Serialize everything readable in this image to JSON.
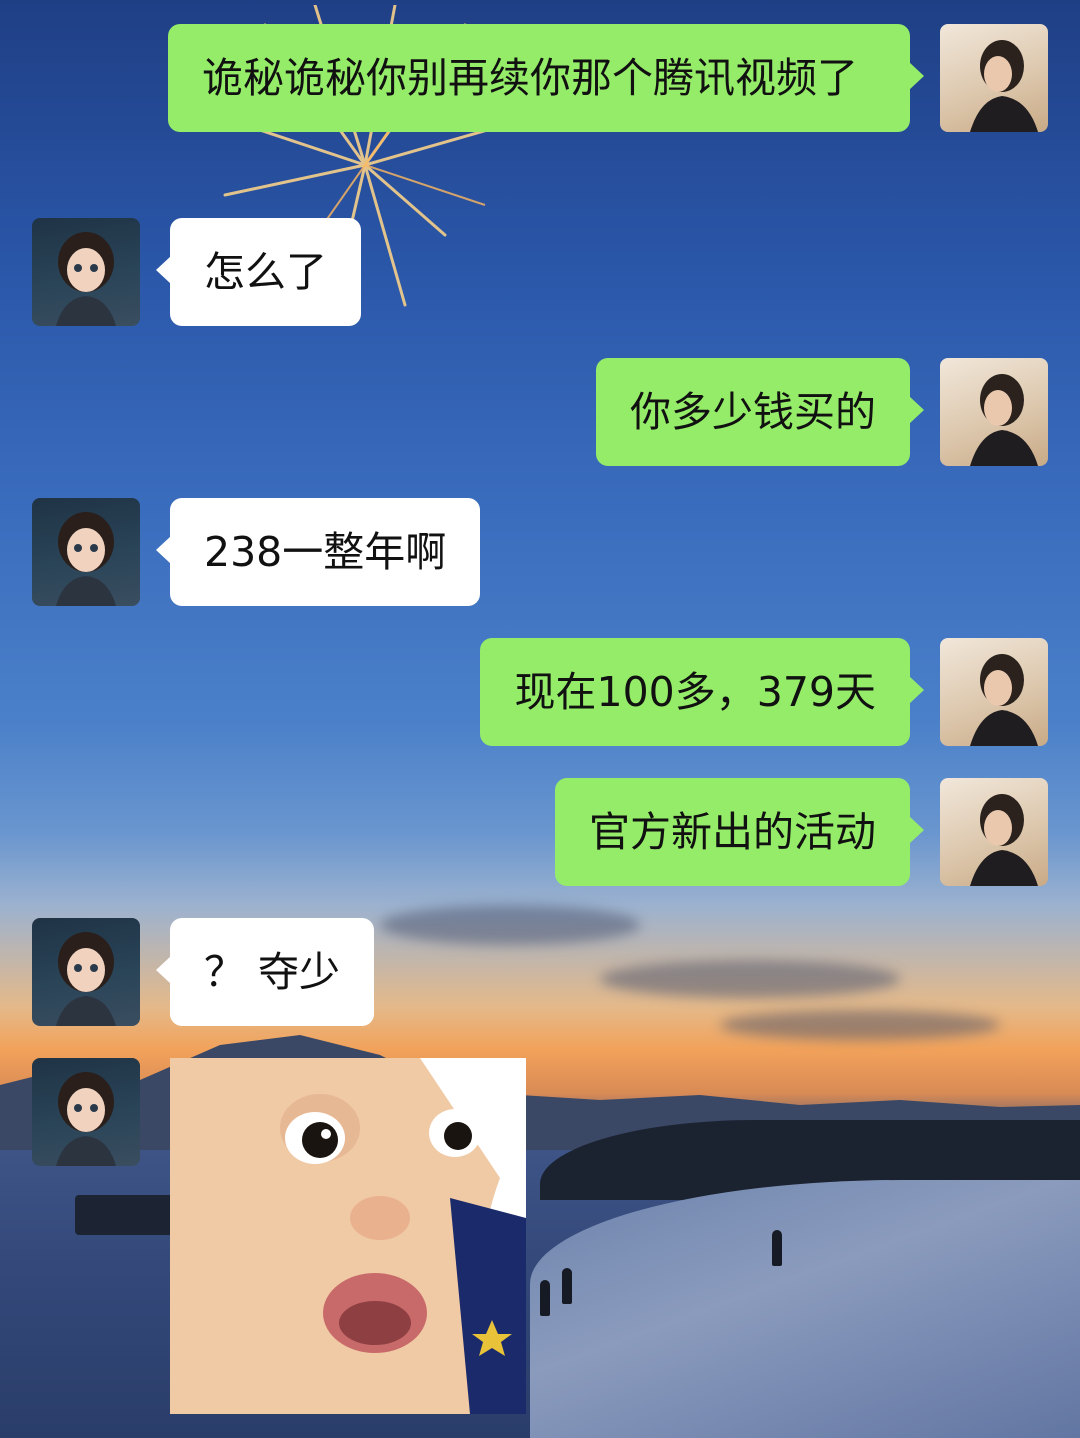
{
  "messages": [
    {
      "sender": "self",
      "text": "诡秘诡秘你别再续你那个腾讯视频了"
    },
    {
      "sender": "other",
      "text": "怎么了"
    },
    {
      "sender": "self",
      "text": "你多少钱买的"
    },
    {
      "sender": "other",
      "text": "238一整年啊"
    },
    {
      "sender": "self",
      "text": "现在100多，379天"
    },
    {
      "sender": "self",
      "text": "官方新出的活动"
    },
    {
      "sender": "other",
      "text": "？ 夺少"
    },
    {
      "sender": "other",
      "type": "sticker",
      "sticker_icon": "surprised-baby-sticker"
    }
  ],
  "colors": {
    "self_bubble": "#95ec69",
    "other_bubble": "#ffffff"
  }
}
